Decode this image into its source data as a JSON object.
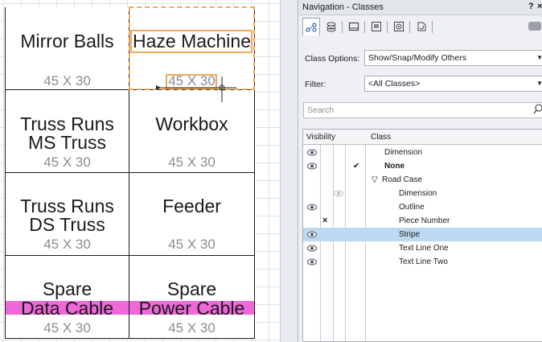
{
  "canvas": {
    "cells": [
      {
        "lines": [
          "Mirror Balls"
        ],
        "dim": "45 X 30"
      },
      {
        "lines": [
          "Haze Machine"
        ],
        "dim": "45 X 30"
      },
      {
        "lines": [
          "Truss Runs",
          "MS Truss"
        ],
        "dim": "45 X 30"
      },
      {
        "lines": [
          "Workbox"
        ],
        "dim": "45 X 30"
      },
      {
        "lines": [
          "Truss Runs",
          "DS Truss"
        ],
        "dim": "45 X 30"
      },
      {
        "lines": [
          "Feeder"
        ],
        "dim": "45 X 30"
      },
      {
        "lines": [
          "Spare",
          "Data Cable"
        ],
        "dim": "45 X 30"
      },
      {
        "lines": [
          "Spare",
          "Power Cable"
        ],
        "dim": "45 X 30"
      }
    ],
    "colors": {
      "highlight": "#f0a85a",
      "pink_band": "#ee68d8",
      "grid": "#dde3ea"
    }
  },
  "palette": {
    "title": "Navigation - Classes",
    "help_icon": "?",
    "close_icon": "×",
    "tabs": [
      {
        "icon": "classes-icon",
        "active": true
      },
      {
        "icon": "design-layers-icon",
        "active": false
      },
      {
        "icon": "sheet-layers-icon",
        "active": false
      },
      {
        "icon": "viewports-icon",
        "active": false
      },
      {
        "icon": "saved-views-icon",
        "active": false
      },
      {
        "icon": "referenced-files-icon",
        "active": false
      }
    ],
    "class_options_label": "Class Options:",
    "class_options_value": "Show/Snap/Modify Others",
    "filter_label": "Filter:",
    "filter_value": "<All Classes>",
    "search_placeholder": "Search",
    "columns": {
      "visibility": "Visibility",
      "class": "Class"
    },
    "rows": [
      {
        "name": "Dimension",
        "visible": "eye",
        "active_mark": "",
        "indent": 0,
        "bold": false,
        "selected": false
      },
      {
        "name": "None",
        "visible": "eye",
        "active_mark": "✔",
        "indent": 0,
        "bold": true,
        "selected": false
      },
      {
        "name": "Road Case",
        "visible": "",
        "active_mark": "",
        "indent": 0,
        "bold": false,
        "selected": false,
        "expander": "▽"
      },
      {
        "name": "Dimension",
        "visible": "grey-eye",
        "active_mark": "",
        "indent": 1,
        "bold": false,
        "selected": false
      },
      {
        "name": "Outline",
        "visible": "eye",
        "active_mark": "",
        "indent": 1,
        "bold": false,
        "selected": false
      },
      {
        "name": "Piece Number",
        "visible": "invisible",
        "active_mark": "",
        "indent": 1,
        "bold": false,
        "selected": false
      },
      {
        "name": "Stripe",
        "visible": "eye",
        "active_mark": "",
        "indent": 1,
        "bold": false,
        "selected": true
      },
      {
        "name": "Text Line One",
        "visible": "eye",
        "active_mark": "",
        "indent": 1,
        "bold": false,
        "selected": false
      },
      {
        "name": "Text Line Two",
        "visible": "eye",
        "active_mark": "",
        "indent": 1,
        "bold": false,
        "selected": false
      }
    ],
    "invisible_mark": "×",
    "selected_color": "#bcd9f2"
  }
}
